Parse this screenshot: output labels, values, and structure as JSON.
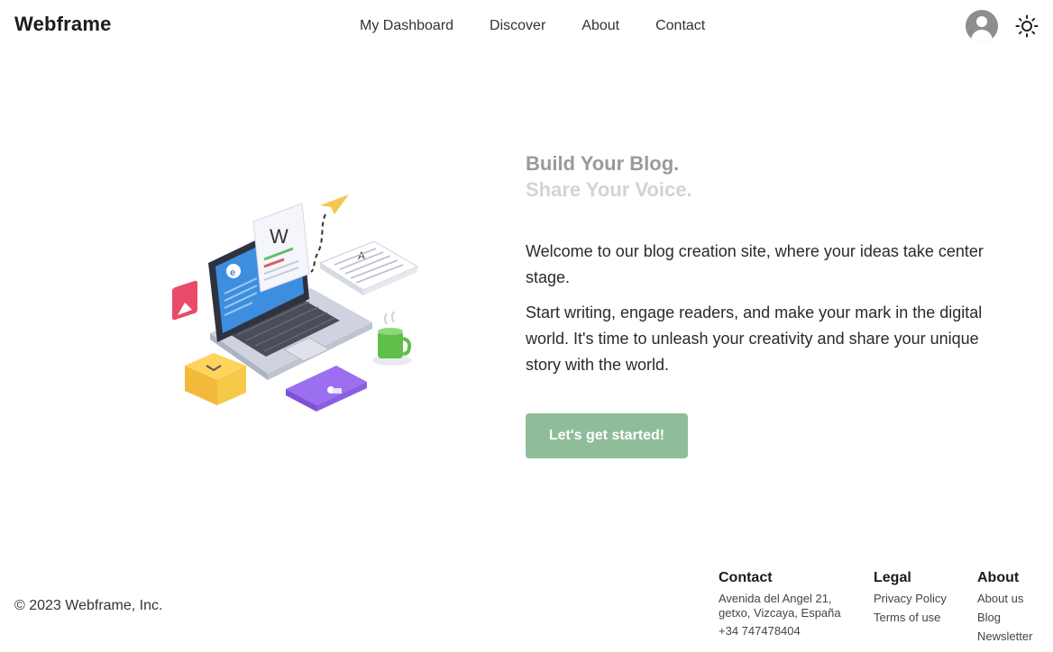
{
  "header": {
    "brand": "Webframe",
    "nav": [
      "My Dashboard",
      "Discover",
      "About",
      "Contact"
    ]
  },
  "hero": {
    "title_line1": "Build Your Blog.",
    "title_line2": "Share Your Voice.",
    "paragraph1": "Welcome to our blog creation site, where your ideas take center stage.",
    "paragraph2": "Start writing, engage readers, and make your mark in the digital world. It's time to unleash your creativity and share your unique story with the world.",
    "cta_label": "Let's get started!",
    "illustration_glyphs": {
      "document_letter": "W",
      "paper_letter": "A"
    }
  },
  "footer": {
    "copyright": "© 2023 Webframe, Inc.",
    "contact": {
      "heading": "Contact",
      "address_line1": "Avenida del Angel 21,",
      "address_line2": "getxo, Vizcaya, España",
      "phone": "+34 747478404"
    },
    "legal": {
      "heading": "Legal",
      "links": [
        "Privacy Policy",
        "Terms of use"
      ]
    },
    "about": {
      "heading": "About",
      "links": [
        "About us",
        "Blog",
        "Newsletter"
      ]
    }
  },
  "icons": {
    "avatar": "user-avatar-icon",
    "theme": "sun-icon"
  },
  "colors": {
    "cta": "#8fbc99",
    "title_primary": "#9a9a9a",
    "title_faded": "#d3d3d3"
  }
}
